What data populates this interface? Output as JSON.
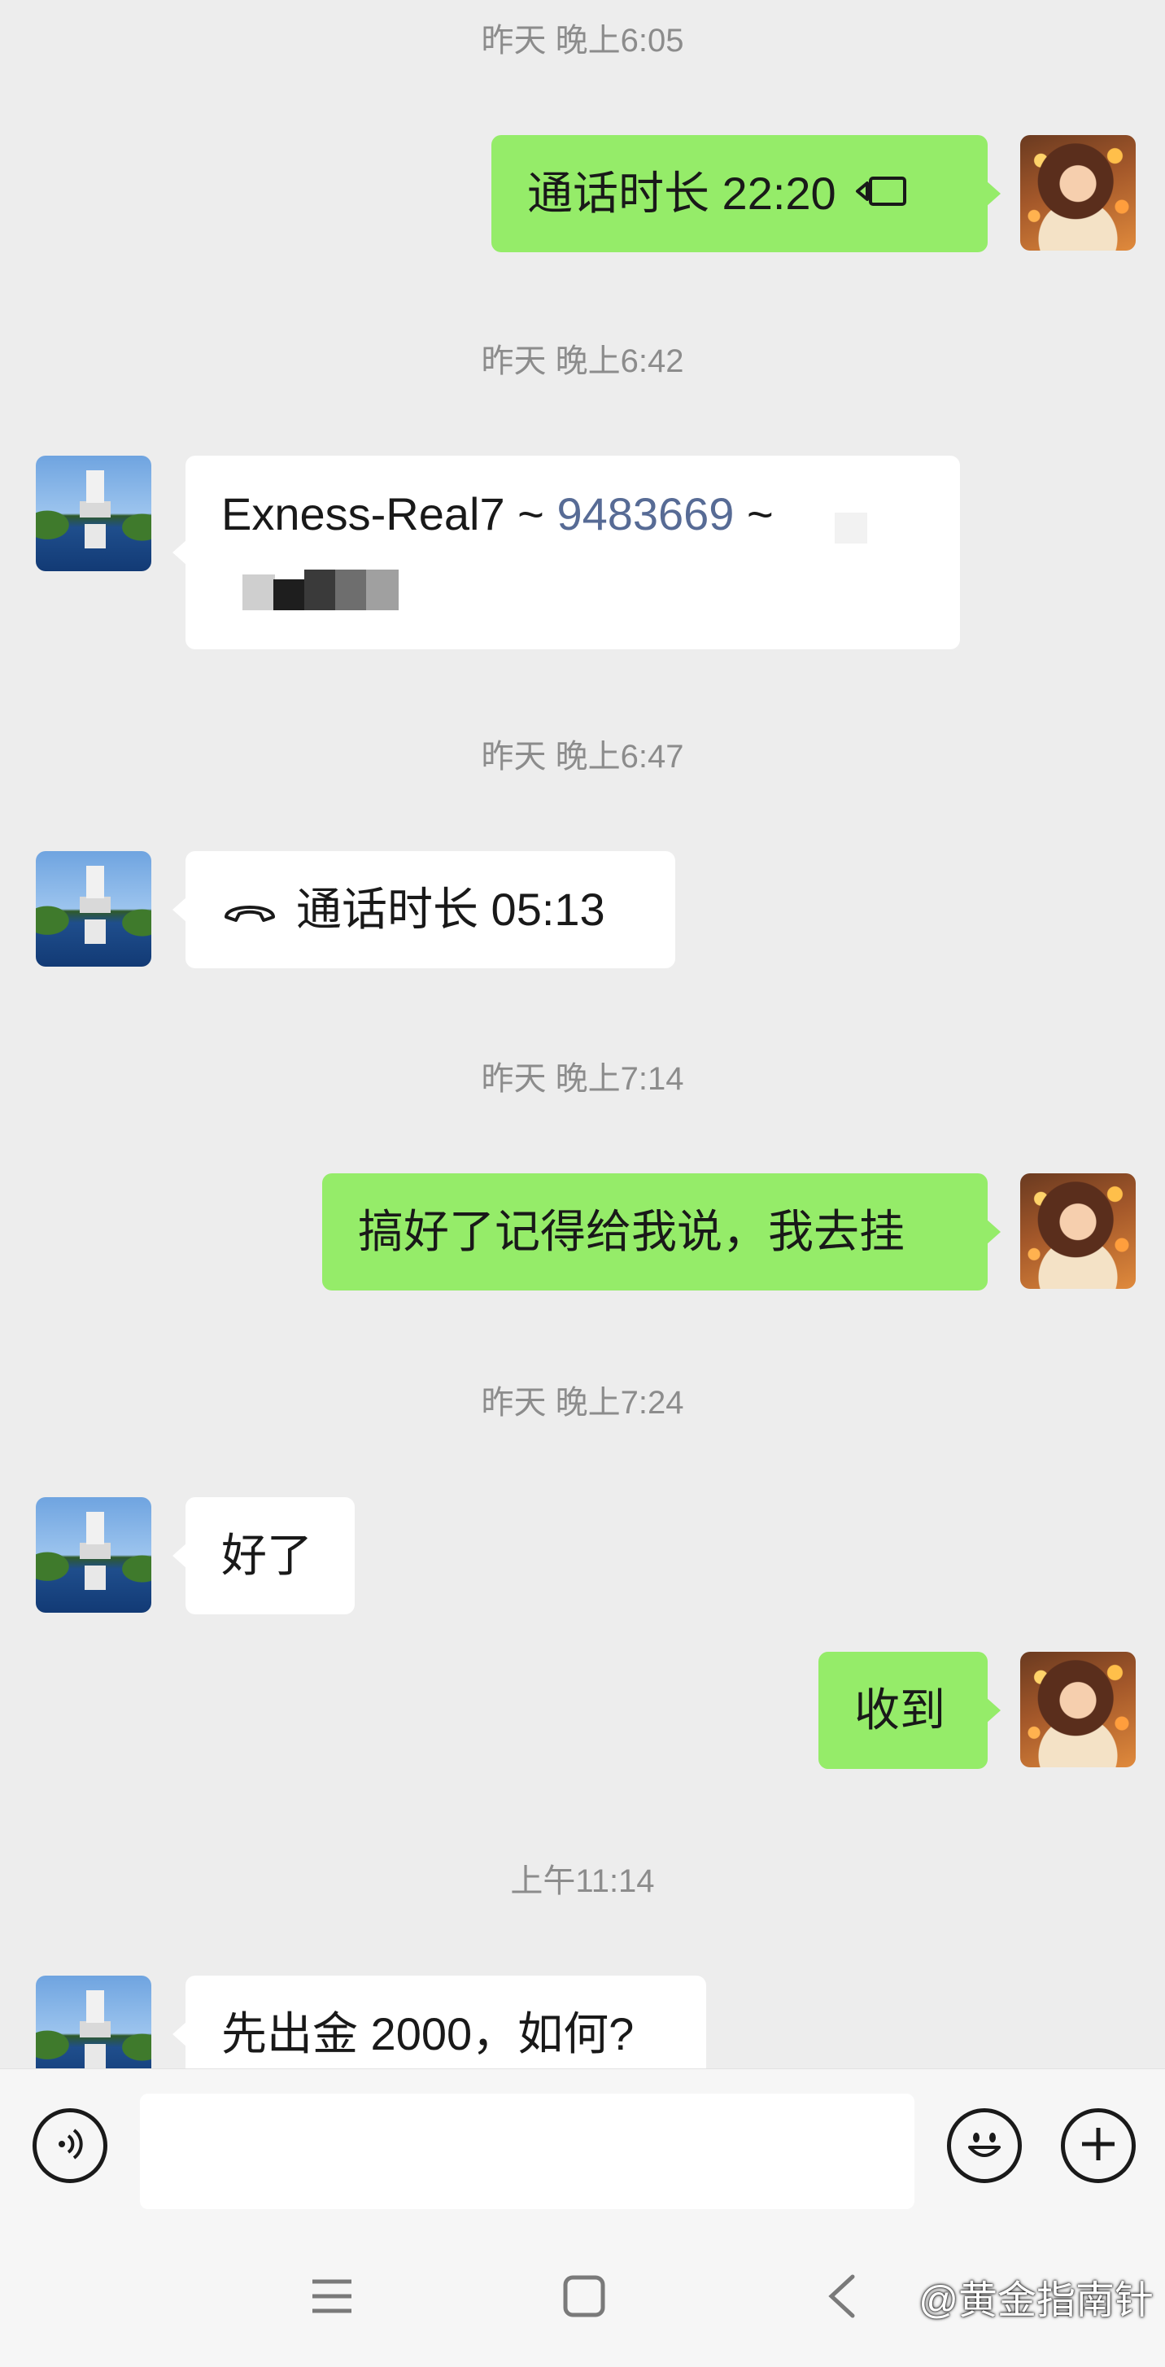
{
  "messages": {
    "ts1": "昨天 晚上6:05",
    "video_call_text": "通话时长 22:20",
    "ts2": "昨天 晚上6:42",
    "acct_prefix": "Exness-Real7 ~ ",
    "acct_number": "9483669",
    "acct_suffix": " ~ ",
    "ts3": "昨天 晚上6:47",
    "voice_call_text": "通话时长 05:13",
    "ts4": "昨天 晚上7:14",
    "msg_remember": "搞好了记得给我说，我去挂",
    "ts5": "昨天 晚上7:24",
    "msg_done": "好了",
    "msg_received": "收到",
    "ts6": "上午11:14",
    "msg_withdraw": "先出金 2000，如何?"
  },
  "input_bar": {
    "voice_icon": "voice-mode-icon",
    "emoji_icon": "emoji-icon",
    "plus_icon": "plus-icon"
  },
  "nav": {
    "menu_icon": "menu-icon",
    "home_icon": "home-icon",
    "back_icon": "back-icon"
  },
  "watermark": "@黄金指南针",
  "colors": {
    "background": "#ededed",
    "my_bubble": "#95ec69",
    "their_bubble": "#ffffff",
    "link_blue": "#576b95",
    "timestamp": "#8c8c8c"
  }
}
